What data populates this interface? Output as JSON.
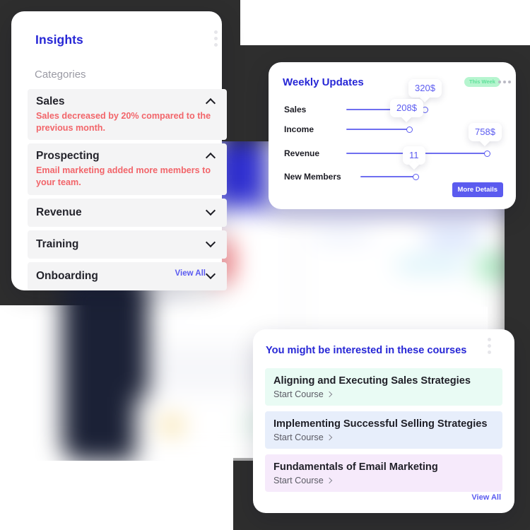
{
  "theme": {
    "brand_blue": "#2727d6",
    "accent_indigo": "#5b5bf0",
    "alert_red": "#f2656a",
    "badge_green_bg": "#b6f5cf",
    "badge_green_text": "#5fe09a",
    "panel_dark": "#2e2e2e",
    "card_white": "#ffffff",
    "row_gray": "#f4f4f5"
  },
  "insights": {
    "title": "Insights",
    "menu_icon": "kebab-menu-icon",
    "section_label": "Categories",
    "view_all": "View All",
    "categories": [
      {
        "name": "Sales",
        "expanded": true,
        "chevron": "chevron-up-icon",
        "description": "Sales decreased by 20% compared to the previous month."
      },
      {
        "name": "Prospecting",
        "expanded": true,
        "chevron": "chevron-up-icon",
        "description": "Email marketing added more members to your team."
      },
      {
        "name": "Revenue",
        "expanded": false,
        "chevron": "chevron-down-icon",
        "description": ""
      },
      {
        "name": "Training",
        "expanded": false,
        "chevron": "chevron-down-icon",
        "description": ""
      },
      {
        "name": "Onboarding",
        "expanded": false,
        "chevron": "chevron-down-icon",
        "description": ""
      }
    ]
  },
  "weekly": {
    "title": "Weekly Updates",
    "badge": "This Week",
    "menu_icon": "kebab-menu-horizontal-icon",
    "more_details": "More Details",
    "metrics": [
      {
        "label": "Sales",
        "value": "320$"
      },
      {
        "label": "Income",
        "value": "208$"
      },
      {
        "label": "Revenue",
        "value": "758$"
      },
      {
        "label": "New Members",
        "value": "11"
      }
    ]
  },
  "courses": {
    "title": "You might be interested in these courses",
    "menu_icon": "kebab-menu-icon",
    "view_all": "View All",
    "items": [
      {
        "name": "Aligning and Executing Sales Strategies",
        "cta": "Start Course",
        "bg": "#e9fbf4"
      },
      {
        "name": "Implementing Successful Selling Strategies",
        "cta": "Start Course",
        "bg": "#e7eefb"
      },
      {
        "name": "Fundamentals of Email Marketing",
        "cta": "Start Course",
        "bg": "#f6eafb"
      }
    ]
  }
}
